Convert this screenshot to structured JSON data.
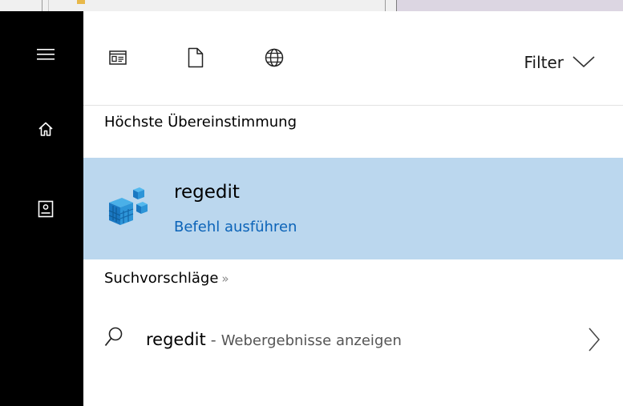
{
  "rail": {
    "items": [
      {
        "name": "hamburger-menu-icon"
      },
      {
        "name": "home-icon"
      },
      {
        "name": "notebook-icon"
      }
    ]
  },
  "toolbar": {
    "filter_label": "Filter",
    "icons": [
      "apps-icon",
      "documents-icon",
      "web-icon"
    ]
  },
  "best_match": {
    "section_title": "Höchste Übereinstimmung",
    "title": "regedit",
    "subtitle": "Befehl ausführen"
  },
  "suggestions": {
    "section_title": "Suchvorschläge",
    "arrows": "»",
    "item": {
      "term": "regedit",
      "separator": " - ",
      "hint": "Webergebnisse anzeigen"
    }
  },
  "colors": {
    "rail": "#000000",
    "highlight": "#bbd7ee",
    "link": "#0b63b8"
  }
}
